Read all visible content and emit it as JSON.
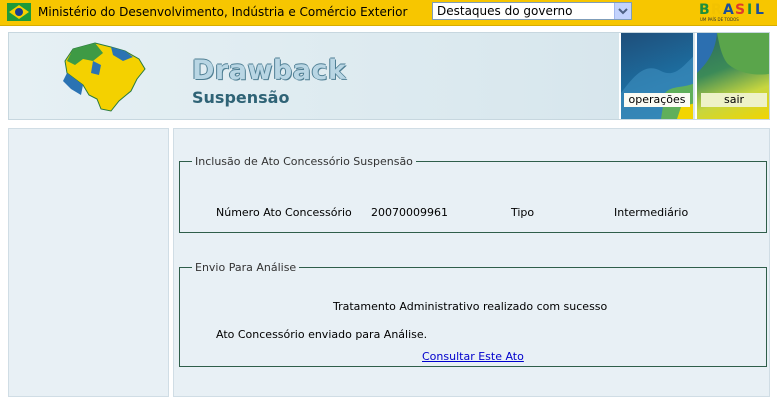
{
  "gov_bar": {
    "ministry": "Ministério do Desenvolvimento, Indústria e Comércio Exterior",
    "dropdown_selected": "Destaques do governo",
    "brasil_logo": "BRASIL",
    "brasil_tagline": "UM PAÍS DE TODOS"
  },
  "header": {
    "title": "Drawback",
    "subtitle": "Suspensão",
    "nav": {
      "operacoes": "operações",
      "sair": "sair"
    }
  },
  "inclusao": {
    "legend": "Inclusão de Ato Concessório Suspensão",
    "numero_label": "Número Ato Concessório",
    "numero_value": "20070009961",
    "tipo_label": "Tipo",
    "tipo_value": "Intermediário"
  },
  "envio": {
    "legend": "Envio Para Análise",
    "success_message": "Tratamento Administrativo realizado com sucesso",
    "sent_message": "Ato Concessório enviado para Análise.",
    "consult_link": "Consultar Este Ato"
  },
  "colors": {
    "gov_bar": "#f7c600",
    "panel_bg": "#e8f0f5",
    "fieldset_border": "#2f5e4a",
    "link": "#0000cc"
  },
  "icons": [
    "brazil-flag-icon",
    "dropdown-arrow-icon",
    "brazil-map-icon"
  ]
}
